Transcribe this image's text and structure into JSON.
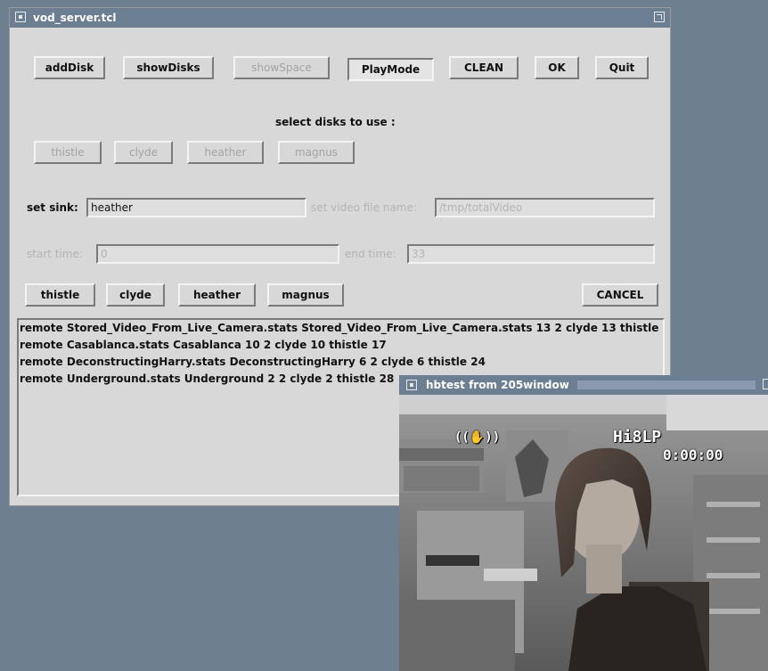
{
  "main_window": {
    "title": "vod_server.tcl",
    "toolbar": {
      "add_disk": "addDisk",
      "show_disks": "showDisks",
      "show_space": "showSpace",
      "play_mode": "PlayMode",
      "clean": "CLEAN",
      "ok": "OK",
      "quit": "Quit"
    },
    "select_disks_label": "select disks to use :",
    "disk_options": [
      "thistle",
      "clyde",
      "heather",
      "magnus"
    ],
    "set_sink_label": "set sink:",
    "set_sink_value": "heather",
    "video_file_label": "set video file name:",
    "video_file_value": "/tmp/totalVideo",
    "start_time_label": "start time:",
    "start_time_value": "0",
    "end_time_label": "end time:",
    "end_time_value": "33",
    "disk_buttons": [
      "thistle",
      "clyde",
      "heather",
      "magnus"
    ],
    "cancel_label": "CANCEL",
    "list_rows": [
      "remote Stored_Video_From_Live_Camera.stats Stored_Video_From_Live_Camera.stats 13 2 clyde 13 thistle",
      "remote Casablanca.stats Casablanca 10 2 clyde 10 thistle 17",
      "remote DeconstructingHarry.stats DeconstructingHarry 6 2 clyde 6 thistle 24",
      "remote Underground.stats Underground 2 2 clyde 2 thistle 28"
    ]
  },
  "video_window": {
    "title": "hbtest from 205window",
    "hud_tape": "Hi8LP",
    "hud_time": "0:00:00",
    "hud_icon": "hand-icon"
  }
}
